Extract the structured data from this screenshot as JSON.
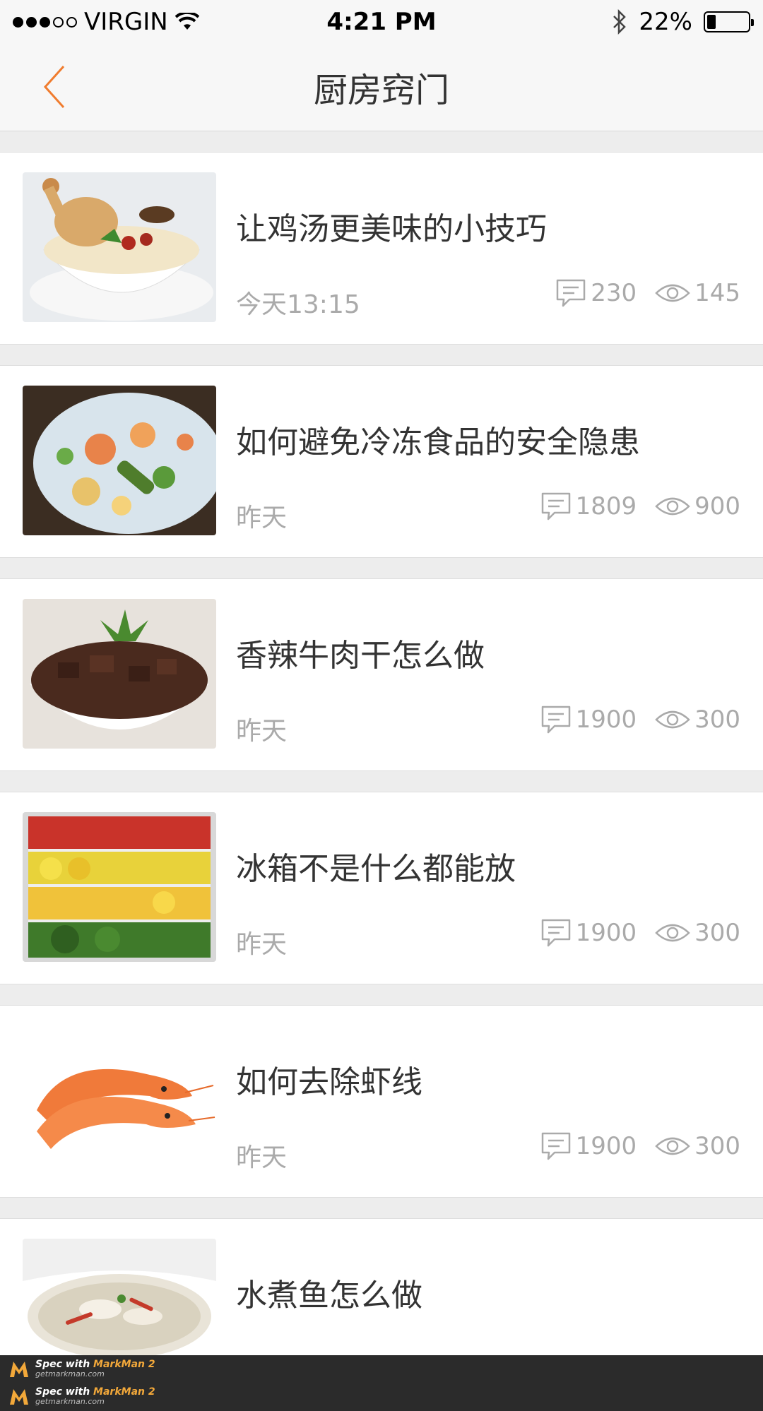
{
  "status_bar": {
    "carrier": "VIRGIN",
    "time": "4:21 PM",
    "battery": "22%",
    "battery_level": 0.22
  },
  "nav": {
    "title": "厨房窍门",
    "back_icon": "chevron-left-icon",
    "accent_color": "#f07c2e"
  },
  "articles": [
    {
      "title": "让鸡汤更美味的小技巧",
      "date": "今天13:15",
      "comments": "230",
      "views": "145",
      "image": "chicken-soup"
    },
    {
      "title": "如何避免冷冻食品的安全隐患",
      "date": "昨天",
      "comments": "1809",
      "views": "900",
      "image": "frozen-vegetables"
    },
    {
      "title": "香辣牛肉干怎么做",
      "date": "昨天",
      "comments": "1900",
      "views": "300",
      "image": "beef-jerky"
    },
    {
      "title": "冰箱不是什么都能放",
      "date": "昨天",
      "comments": "1900",
      "views": "300",
      "image": "fridge-fruits"
    },
    {
      "title": "如何去除虾线",
      "date": "昨天",
      "comments": "1900",
      "views": "300",
      "image": "shrimp"
    },
    {
      "title": "水煮鱼怎么做",
      "date": "",
      "comments": "",
      "views": "",
      "image": "boiled-fish"
    }
  ],
  "footer": {
    "line1_prefix": "Spec with",
    "line1_brand": "MarkMan 2",
    "line1_url": "getmarkman.com",
    "line2_prefix": "Spec with",
    "line2_brand": "MarkMan 2",
    "line2_url": "getmarkman.com"
  },
  "colors": {
    "title_text": "#333333",
    "meta_text": "#aaaaaa",
    "separator": "#ededed"
  }
}
